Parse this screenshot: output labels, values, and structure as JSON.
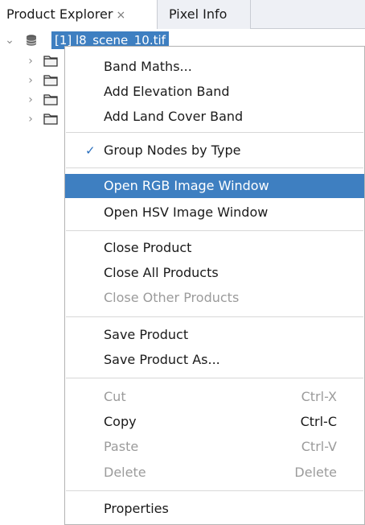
{
  "tabs": [
    {
      "label": "Product Explorer",
      "close": "×"
    },
    {
      "label": "Pixel Info"
    }
  ],
  "tree": {
    "root_label": "[1] l8_scene_10.tif",
    "root_expanded": true,
    "child_folders_count": 4
  },
  "menu": {
    "items": [
      {
        "label": "Band Maths...",
        "enabled": true
      },
      {
        "label": "Add Elevation Band",
        "enabled": true
      },
      {
        "label": "Add Land Cover Band",
        "enabled": true
      },
      {
        "label": "Group Nodes by Type",
        "enabled": true,
        "checked": true,
        "check_glyph": "✓"
      },
      {
        "label": "Open RGB Image Window",
        "enabled": true,
        "highlighted": true
      },
      {
        "label": "Open HSV Image Window",
        "enabled": true
      },
      {
        "label": "Close Product",
        "enabled": true
      },
      {
        "label": "Close All Products",
        "enabled": true
      },
      {
        "label": "Close Other Products",
        "enabled": false
      },
      {
        "label": "Save Product",
        "enabled": true
      },
      {
        "label": "Save Product As...",
        "enabled": true
      },
      {
        "label": "Cut",
        "shortcut": "Ctrl-X",
        "enabled": false
      },
      {
        "label": "Copy",
        "shortcut": "Ctrl-C",
        "enabled": true
      },
      {
        "label": "Paste",
        "shortcut": "Ctrl-V",
        "enabled": false
      },
      {
        "label": "Delete",
        "shortcut": "Delete",
        "enabled": false
      },
      {
        "label": "Properties",
        "enabled": true
      }
    ]
  },
  "colors": {
    "selection": "#3e7fc1",
    "disabled_text": "#9b9b9b",
    "check": "#2a6fbe"
  }
}
